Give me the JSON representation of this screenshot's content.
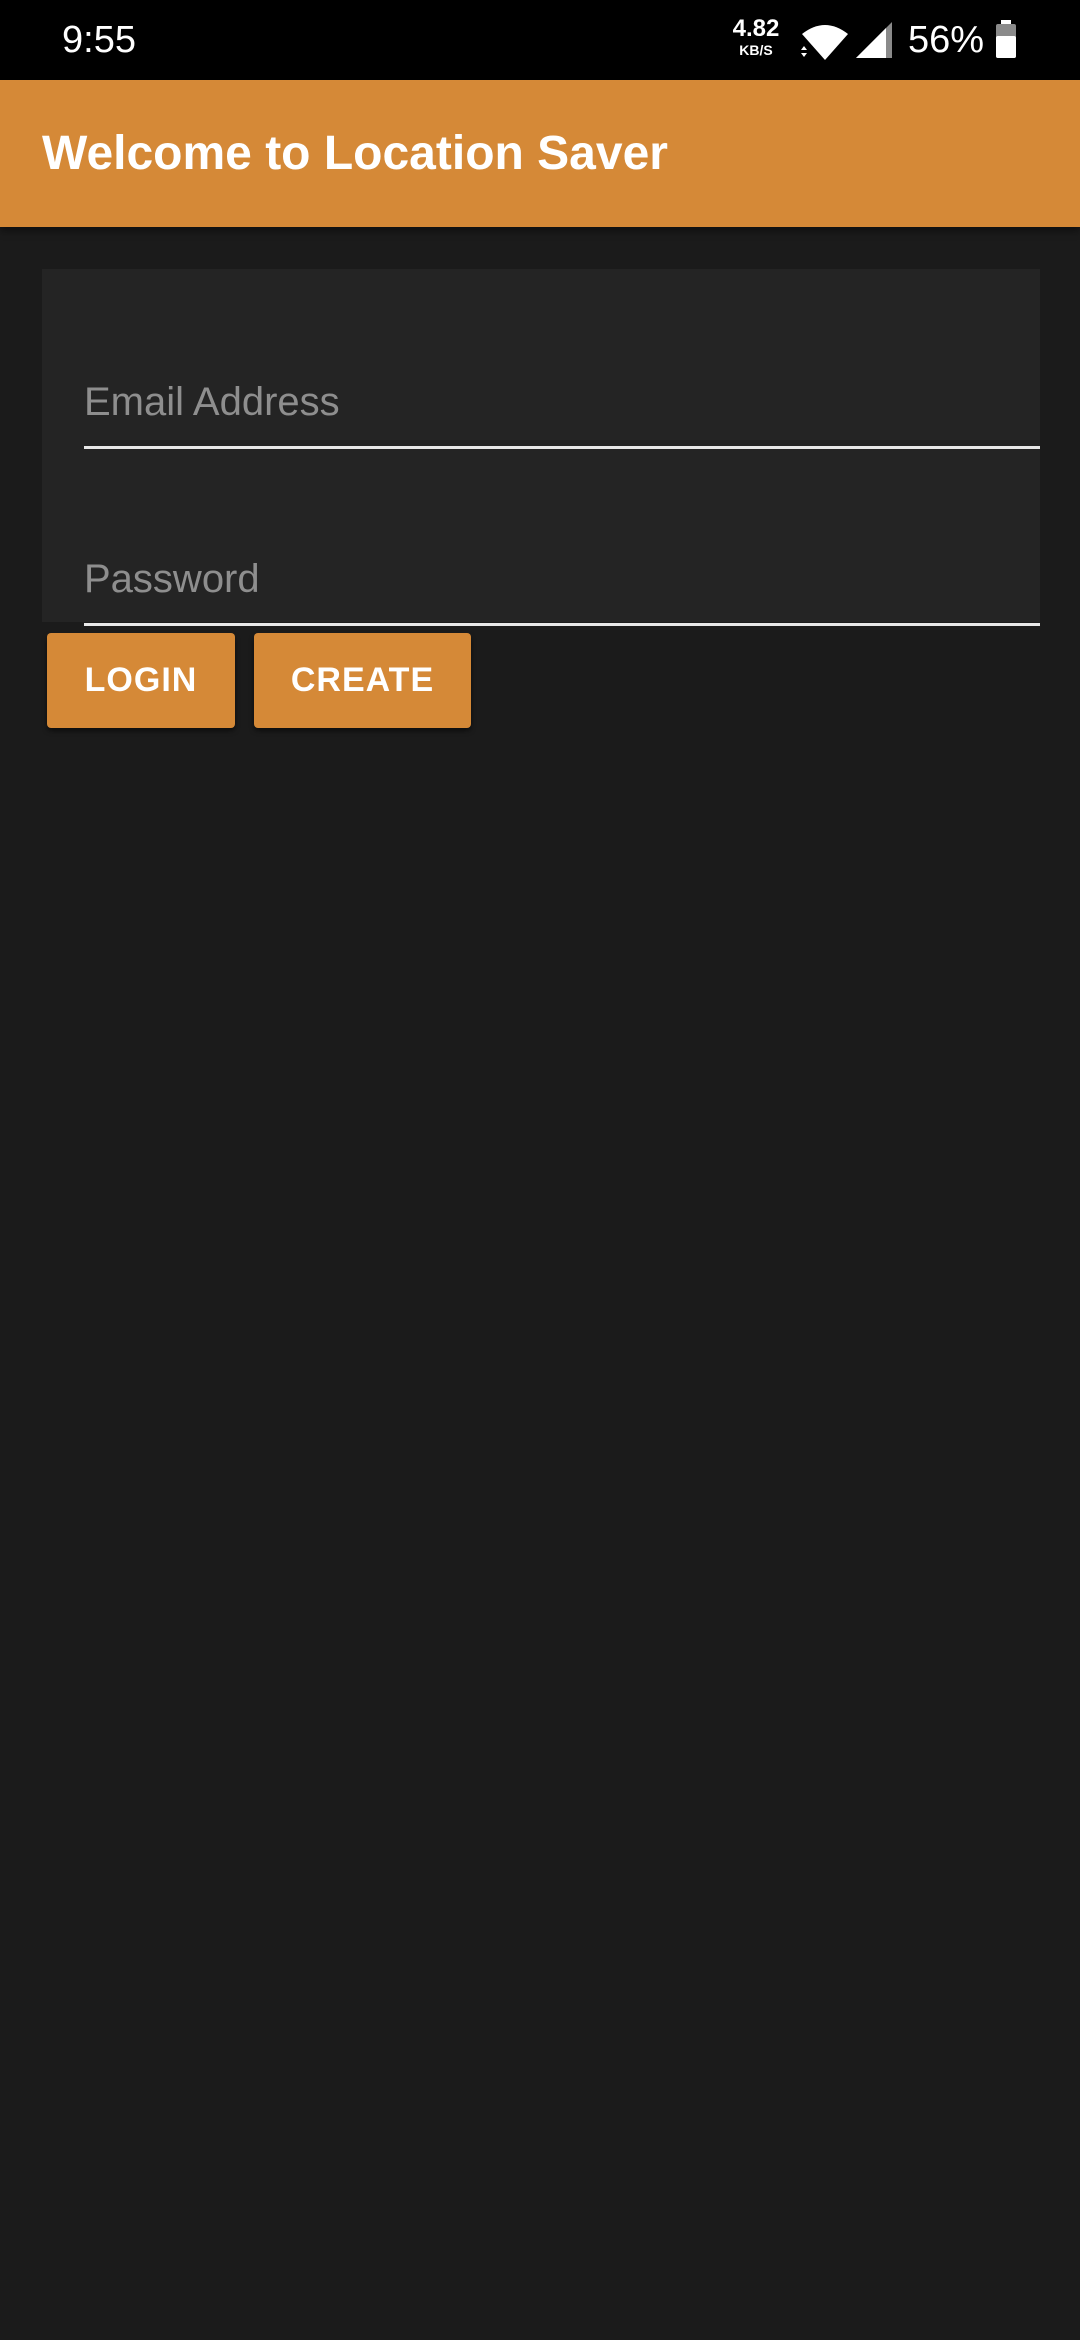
{
  "status_bar": {
    "time": "9:55",
    "net_speed_value": "4.82",
    "net_speed_unit": "KB/S",
    "battery_percent": "56%",
    "icons": [
      "wifi-icon",
      "signal-icon",
      "battery-icon"
    ]
  },
  "app_bar": {
    "title": "Welcome to Location Saver",
    "color": "#d58937"
  },
  "form": {
    "email": {
      "value": "",
      "placeholder": "Email Address"
    },
    "password": {
      "value": "",
      "placeholder": "Password"
    }
  },
  "buttons": {
    "login_label": "LOGIN",
    "create_label": "CREATE"
  },
  "colors": {
    "accent": "#d58937",
    "background": "#1b1b1b",
    "card": "#242424"
  }
}
